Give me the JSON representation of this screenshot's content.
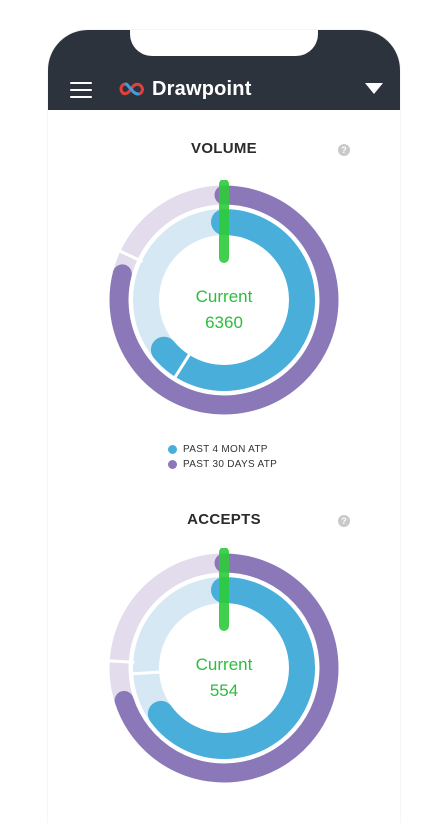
{
  "app": {
    "name": "Drawpoint"
  },
  "colors": {
    "topbar": "#2c333d",
    "past_4_mon": "#4aaedb",
    "past_4_mon_track": "#d5e8f3",
    "past_30_days": "#8b78b8",
    "past_30_days_track": "#e2dcec",
    "current": "#2dcc3a"
  },
  "icons": {
    "menu": "hamburger-menu-icon",
    "dropdown": "triangle-down-icon",
    "help": "question-circle-icon"
  },
  "legend": [
    {
      "label": "PAST 4 MON ATP",
      "color": "#4aaedb"
    },
    {
      "label": "PAST 30 DAYS ATP",
      "color": "#8b78b8"
    }
  ],
  "sections": [
    {
      "title": "VOLUME",
      "help": "?",
      "current_label": "Current",
      "current_value": "6360"
    },
    {
      "title": "ACCEPTS",
      "help": "?",
      "current_label": "Current",
      "current_value": "554"
    }
  ],
  "chart_data": [
    {
      "type": "gauge",
      "title": "VOLUME",
      "series": [
        {
          "name": "PAST 4 MON ATP",
          "fraction": 0.64
        },
        {
          "name": "PAST 30 DAYS ATP",
          "fraction": 0.79
        }
      ],
      "current": 6360
    },
    {
      "type": "gauge",
      "title": "ACCEPTS",
      "series": [
        {
          "name": "PAST 4 MON ATP",
          "fraction": 0.65
        },
        {
          "name": "PAST 30 DAYS ATP",
          "fraction": 0.7
        }
      ],
      "current": 554
    }
  ]
}
